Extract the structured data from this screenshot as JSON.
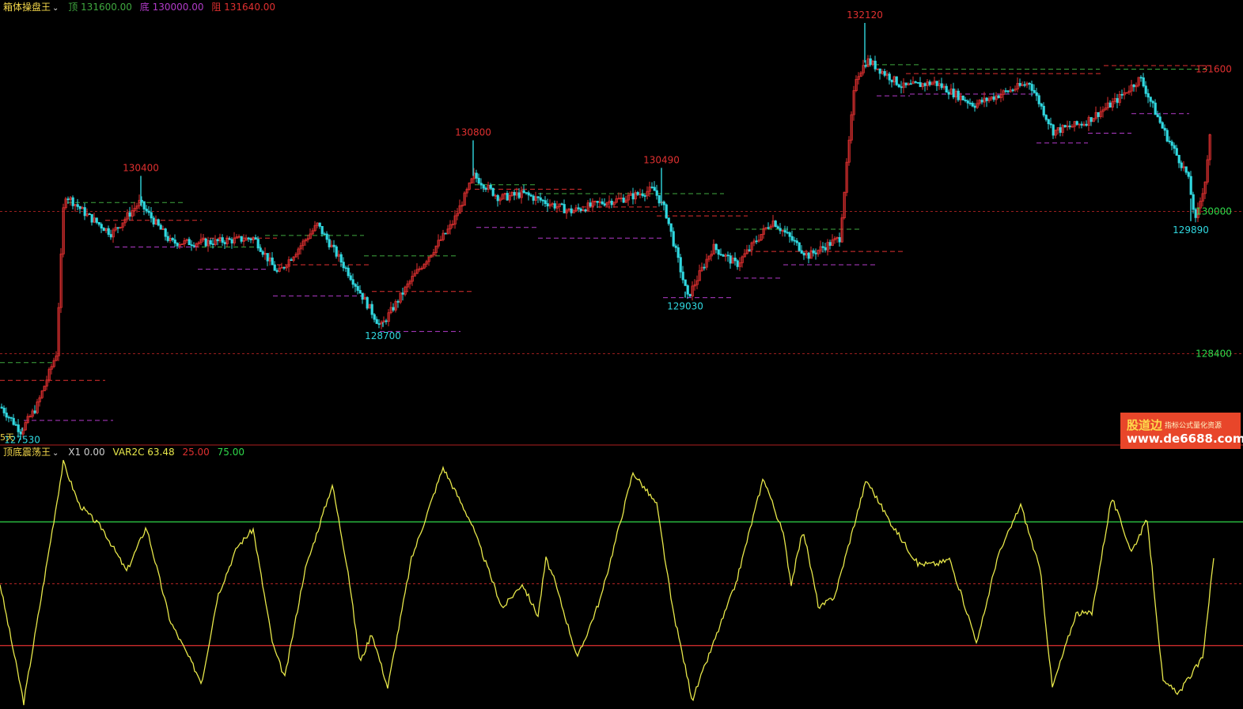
{
  "top_panel": {
    "title": "箱体操盘王",
    "legend": [
      {
        "label": "顶 131600.00",
        "color": "#3fa83f"
      },
      {
        "label": "底 130000.00",
        "color": "#b23bc9"
      },
      {
        "label": "阻 131640.00",
        "color": "#e03030"
      }
    ],
    "left_bottom_label": "5天",
    "right_levels": [
      {
        "value": "131600",
        "color": "#e03030"
      },
      {
        "value": "130000",
        "color": "#2fd84a"
      },
      {
        "value": "128400",
        "color": "#2fd84a"
      }
    ]
  },
  "bottom_panel": {
    "title": "顶底震荡王",
    "legend": [
      {
        "label": "X1 0.00",
        "color": "#cfcfcf"
      },
      {
        "label": "VAR2C 63.48",
        "color": "#e8e84a"
      },
      {
        "label": "25.00",
        "color": "#e03030"
      },
      {
        "label": "75.00",
        "color": "#2fd84a"
      }
    ]
  },
  "watermark": {
    "brand": "股道边",
    "tagline": "指标公式量化资源",
    "url": "www.de6688.com"
  },
  "colors": {
    "background": "#000000",
    "up_candle": "#e03030",
    "down_candle": "#30d8e0",
    "box_top": "#3fa83f",
    "box_bottom": "#b23bc9",
    "resistance": "#e03030",
    "oscillator": "#e8e84a"
  },
  "chart_data": [
    {
      "type": "candlestick",
      "ylim": [
        127400,
        132200
      ],
      "reference_lines": [
        130000,
        128400
      ],
      "anchors": [
        [
          0,
          127800
        ],
        [
          25,
          127530
        ],
        [
          45,
          127800
        ],
        [
          70,
          128400
        ],
        [
          80,
          130200
        ],
        [
          110,
          129950
        ],
        [
          140,
          129750
        ],
        [
          175,
          130100
        ],
        [
          215,
          129650
        ],
        [
          260,
          129650
        ],
        [
          320,
          129700
        ],
        [
          350,
          129300
        ],
        [
          400,
          129850
        ],
        [
          440,
          129300
        ],
        [
          480,
          128700
        ],
        [
          520,
          129250
        ],
        [
          570,
          129850
        ],
        [
          598,
          130400
        ],
        [
          630,
          130150
        ],
        [
          660,
          130200
        ],
        [
          720,
          130000
        ],
        [
          760,
          130100
        ],
        [
          790,
          130150
        ],
        [
          825,
          130250
        ],
        [
          840,
          130000
        ],
        [
          868,
          129030
        ],
        [
          900,
          129600
        ],
        [
          930,
          129400
        ],
        [
          975,
          129900
        ],
        [
          1020,
          129500
        ],
        [
          1060,
          129700
        ],
        [
          1080,
          131500
        ],
        [
          1095,
          131700
        ],
        [
          1140,
          131400
        ],
        [
          1180,
          131450
        ],
        [
          1230,
          131200
        ],
        [
          1300,
          131450
        ],
        [
          1330,
          130900
        ],
        [
          1370,
          131000
        ],
        [
          1410,
          131250
        ],
        [
          1440,
          131500
        ],
        [
          1470,
          130900
        ],
        [
          1500,
          130400
        ],
        [
          1510,
          129890
        ],
        [
          1522,
          130350
        ],
        [
          1530,
          131000
        ]
      ],
      "extreme_labels": [
        {
          "value": "130400",
          "kind": "high",
          "x_index": 178
        },
        {
          "value": "130800",
          "kind": "high",
          "x_index": 598
        },
        {
          "value": "130490",
          "kind": "high",
          "x_index": 836
        },
        {
          "value": "132120",
          "kind": "high",
          "x_index": 1093
        },
        {
          "value": "128700",
          "kind": "low",
          "x_index": 484
        },
        {
          "value": "129030",
          "kind": "low",
          "x_index": 866
        },
        {
          "value": "129890",
          "kind": "low",
          "x_index": 1505
        },
        {
          "value": "127530",
          "kind": "low",
          "x_index": 28
        }
      ],
      "box_top_segments": [
        [
          0,
          67,
          128300
        ],
        [
          85,
          233,
          130100
        ],
        [
          245,
          330,
          129600
        ],
        [
          335,
          460,
          129730
        ],
        [
          460,
          580,
          129500
        ],
        [
          600,
          680,
          130300
        ],
        [
          680,
          915,
          130200
        ],
        [
          930,
          1090,
          129800
        ],
        [
          1095,
          1165,
          131650
        ],
        [
          1165,
          1390,
          131600
        ],
        [
          1410,
          1530,
          131600
        ]
      ],
      "box_bottom_segments": [
        [
          30,
          143,
          127650
        ],
        [
          145,
          250,
          129600
        ],
        [
          250,
          340,
          129350
        ],
        [
          345,
          460,
          129050
        ],
        [
          480,
          582,
          128650
        ],
        [
          602,
          680,
          129820
        ],
        [
          680,
          840,
          129700
        ],
        [
          838,
          928,
          129030
        ],
        [
          930,
          988,
          129250
        ],
        [
          990,
          1108,
          129400
        ],
        [
          1108,
          1150,
          131300
        ],
        [
          1150,
          1310,
          131320
        ],
        [
          1310,
          1375,
          130770
        ],
        [
          1375,
          1430,
          130880
        ],
        [
          1430,
          1503,
          131100
        ]
      ],
      "resistance_segments": [
        [
          0,
          133,
          128100
        ],
        [
          133,
          255,
          129900
        ],
        [
          255,
          350,
          129700
        ],
        [
          350,
          470,
          129400
        ],
        [
          470,
          600,
          129100
        ],
        [
          600,
          735,
          130250
        ],
        [
          735,
          830,
          130050
        ],
        [
          830,
          945,
          129950
        ],
        [
          945,
          1145,
          129550
        ],
        [
          1145,
          1395,
          131550
        ],
        [
          1395,
          1530,
          131640
        ]
      ]
    },
    {
      "type": "line",
      "series": [
        {
          "name": "VAR2C",
          "last": 63.48
        }
      ],
      "ylim": [
        0,
        100
      ],
      "reference_lines": [
        25,
        50,
        75
      ],
      "anchors": [
        [
          0,
          50
        ],
        [
          30,
          2
        ],
        [
          55,
          50
        ],
        [
          80,
          99
        ],
        [
          100,
          82
        ],
        [
          130,
          72
        ],
        [
          160,
          55
        ],
        [
          185,
          73
        ],
        [
          215,
          35
        ],
        [
          255,
          10
        ],
        [
          275,
          45
        ],
        [
          300,
          65
        ],
        [
          320,
          72
        ],
        [
          345,
          25
        ],
        [
          360,
          12
        ],
        [
          385,
          55
        ],
        [
          420,
          90
        ],
        [
          440,
          55
        ],
        [
          455,
          18
        ],
        [
          470,
          30
        ],
        [
          490,
          8
        ],
        [
          520,
          60
        ],
        [
          560,
          97
        ],
        [
          595,
          75
        ],
        [
          635,
          40
        ],
        [
          660,
          50
        ],
        [
          680,
          37
        ],
        [
          690,
          60
        ],
        [
          700,
          52
        ],
        [
          730,
          20
        ],
        [
          760,
          45
        ],
        [
          800,
          95
        ],
        [
          830,
          82
        ],
        [
          850,
          40
        ],
        [
          875,
          3
        ],
        [
          910,
          33
        ],
        [
          930,
          50
        ],
        [
          965,
          93
        ],
        [
          990,
          70
        ],
        [
          1000,
          50
        ],
        [
          1015,
          72
        ],
        [
          1035,
          40
        ],
        [
          1055,
          45
        ],
        [
          1095,
          92
        ],
        [
          1125,
          75
        ],
        [
          1160,
          58
        ],
        [
          1185,
          58
        ],
        [
          1200,
          60
        ],
        [
          1235,
          26
        ],
        [
          1260,
          60
        ],
        [
          1290,
          82
        ],
        [
          1315,
          55
        ],
        [
          1330,
          8
        ],
        [
          1360,
          38
        ],
        [
          1380,
          38
        ],
        [
          1405,
          85
        ],
        [
          1430,
          63
        ],
        [
          1450,
          76
        ],
        [
          1470,
          10
        ],
        [
          1490,
          6
        ],
        [
          1520,
          20
        ],
        [
          1535,
          63.48
        ]
      ]
    }
  ]
}
